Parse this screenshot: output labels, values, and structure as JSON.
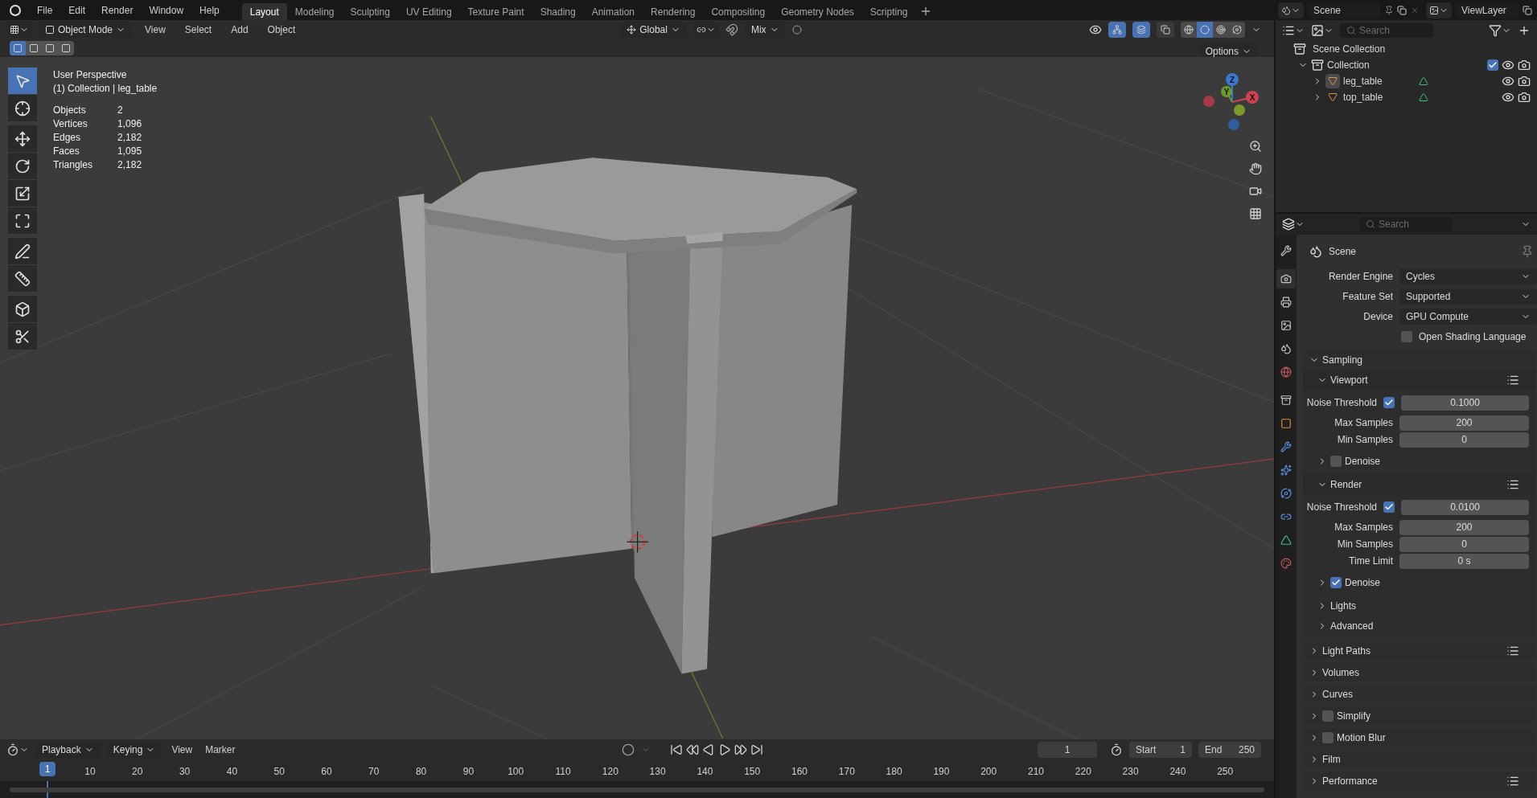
{
  "menu": [
    "File",
    "Edit",
    "Render",
    "Window",
    "Help"
  ],
  "workspaces": [
    {
      "label": "Layout",
      "selected": true
    },
    {
      "label": "Modeling",
      "selected": false
    },
    {
      "label": "Sculpting",
      "selected": false
    },
    {
      "label": "UV Editing",
      "selected": false
    },
    {
      "label": "Texture Paint",
      "selected": false
    },
    {
      "label": "Shading",
      "selected": false
    },
    {
      "label": "Animation",
      "selected": false
    },
    {
      "label": "Rendering",
      "selected": false
    },
    {
      "label": "Compositing",
      "selected": false
    },
    {
      "label": "Geometry Nodes",
      "selected": false
    },
    {
      "label": "Scripting",
      "selected": false
    }
  ],
  "scene_selector": "Scene",
  "view_layer_selector": "ViewLayer",
  "viewport_header": {
    "mode": "Object Mode",
    "menus": [
      "View",
      "Select",
      "Add",
      "Object"
    ],
    "orientation": "Global",
    "snap": "Mix",
    "options": "Options"
  },
  "viewport_toggles": [
    {
      "kind": "gizmos",
      "on": true
    },
    {
      "kind": "overlays",
      "on": true
    },
    {
      "kind": "xray",
      "on": false
    }
  ],
  "shading_modes": [
    {
      "kind": "wireframe",
      "selected": false
    },
    {
      "kind": "solid",
      "selected": true
    },
    {
      "kind": "material",
      "selected": false
    },
    {
      "kind": "rendered",
      "selected": false
    }
  ],
  "select_modes": [
    {
      "selected": true
    },
    {
      "selected": false
    },
    {
      "selected": false
    },
    {
      "selected": false
    }
  ],
  "tools": [
    {
      "kind": "select",
      "selected": true
    },
    {
      "kind": "cursor",
      "selected": false
    },
    {
      "kind": "move",
      "selected": false
    },
    {
      "kind": "rotate",
      "selected": false
    },
    {
      "kind": "scale",
      "selected": false
    },
    {
      "kind": "transform",
      "selected": false
    },
    {
      "kind": "annotate",
      "selected": false
    },
    {
      "kind": "measure",
      "selected": false
    },
    {
      "kind": "add_cube",
      "selected": false
    },
    {
      "kind": "cut",
      "selected": false
    }
  ],
  "overlay": {
    "title": "User Perspective",
    "subtitle": "(1) Collection | leg_table",
    "stats": [
      {
        "label": "Objects",
        "value": "2"
      },
      {
        "label": "Vertices",
        "value": "1,096"
      },
      {
        "label": "Edges",
        "value": "2,182"
      },
      {
        "label": "Faces",
        "value": "1,095"
      },
      {
        "label": "Triangles",
        "value": "2,182"
      }
    ]
  },
  "gizmo_axes": [
    "Z",
    "Y",
    "X"
  ],
  "outliner": {
    "search_placeholder": "Search",
    "root": "Scene Collection",
    "collections": [
      {
        "name": "Collection",
        "expanded": true,
        "checked": true,
        "children": [
          {
            "name": "leg_table",
            "expanded": false,
            "selected": true
          },
          {
            "name": "top_table",
            "expanded": false,
            "selected": false
          }
        ]
      }
    ]
  },
  "properties": {
    "search_placeholder": "Search",
    "context": "Scene",
    "tabs": [
      {
        "kind": "tool",
        "selected": false
      },
      {
        "kind": "render",
        "selected": true
      },
      {
        "kind": "output",
        "selected": false
      },
      {
        "kind": "view_layer",
        "selected": false
      },
      {
        "kind": "scene",
        "selected": false
      },
      {
        "kind": "world",
        "selected": false
      },
      {
        "kind": "collection",
        "selected": false
      },
      {
        "kind": "object",
        "selected": false
      },
      {
        "kind": "modifiers",
        "selected": false
      },
      {
        "kind": "particles",
        "selected": false
      },
      {
        "kind": "physics",
        "selected": false
      },
      {
        "kind": "constraints",
        "selected": false
      },
      {
        "kind": "data",
        "selected": false
      },
      {
        "kind": "material",
        "selected": false
      }
    ],
    "settings": [
      {
        "label": "Render Engine",
        "value": "Cycles"
      },
      {
        "label": "Feature Set",
        "value": "Supported"
      },
      {
        "label": "Device",
        "value": "GPU Compute"
      }
    ],
    "osl": {
      "label": "Open Shading Language",
      "checked": false
    },
    "sampling": {
      "label": "Sampling",
      "expanded": true,
      "subpanels": [
        {
          "label": "Viewport",
          "expanded": true,
          "noise": {
            "label": "Noise Threshold",
            "checked": true,
            "value": "0.1000"
          },
          "fields": [
            {
              "label": "Max Samples",
              "value": "200"
            },
            {
              "label": "Min Samples",
              "value": "0"
            }
          ],
          "denoise": {
            "label": "Denoise",
            "checked": false,
            "expanded": false
          }
        },
        {
          "label": "Render",
          "expanded": true,
          "noise": {
            "label": "Noise Threshold",
            "checked": true,
            "value": "0.0100"
          },
          "fields": [
            {
              "label": "Max Samples",
              "value": "200"
            },
            {
              "label": "Min Samples",
              "value": "0"
            },
            {
              "label": "Time Limit",
              "value": "0 s"
            }
          ],
          "denoise": {
            "label": "Denoise",
            "checked": true,
            "expanded": false
          }
        }
      ],
      "more": [
        {
          "label": "Lights",
          "expanded": false
        },
        {
          "label": "Advanced",
          "expanded": false
        }
      ]
    },
    "panels": [
      {
        "label": "Light Paths",
        "kind": "plain",
        "presets": true,
        "expanded": false
      },
      {
        "label": "Volumes",
        "kind": "plain",
        "presets": false,
        "expanded": false
      },
      {
        "label": "Curves",
        "kind": "plain",
        "presets": false,
        "expanded": false
      },
      {
        "label": "Simplify",
        "kind": "toggle",
        "checked": false,
        "presets": false,
        "expanded": false
      },
      {
        "label": "Motion Blur",
        "kind": "toggle",
        "checked": false,
        "presets": false,
        "expanded": false
      },
      {
        "label": "Film",
        "kind": "plain",
        "presets": false,
        "expanded": false
      },
      {
        "label": "Performance",
        "kind": "plain",
        "presets": true,
        "expanded": false
      }
    ]
  },
  "timeline": {
    "menus": [
      "Playback",
      "Keying",
      "View",
      "Marker"
    ],
    "current_frame": "1",
    "start_label": "Start",
    "start": "1",
    "end_label": "End",
    "end": "250",
    "playhead": "1",
    "ticks": [
      "10",
      "20",
      "30",
      "40",
      "50",
      "60",
      "70",
      "80",
      "90",
      "100",
      "110",
      "120",
      "130",
      "140",
      "150",
      "160",
      "170",
      "180",
      "190",
      "200",
      "210",
      "220",
      "230",
      "240",
      "250"
    ]
  }
}
